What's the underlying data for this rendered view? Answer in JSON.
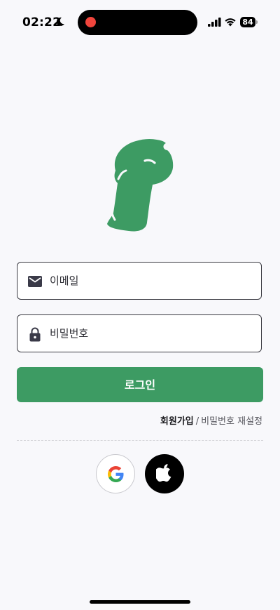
{
  "status_bar": {
    "time": "02:22",
    "battery": "84"
  },
  "colors": {
    "accent": "#3d9b63",
    "background": "#f8f8fb",
    "record_dot": "#f0453c"
  },
  "logo": {
    "icon": "brand-logo"
  },
  "login_form": {
    "email": {
      "placeholder": "이메일",
      "value": "",
      "icon": "mail-icon"
    },
    "password": {
      "placeholder": "비밀번호",
      "value": "",
      "icon": "lock-icon"
    },
    "login_label": "로그인"
  },
  "links": {
    "signup": "회원가입",
    "separator": "/",
    "reset_password": "비밀번호 재설정"
  },
  "social": {
    "google_icon": "google-icon",
    "apple_icon": "apple-icon"
  }
}
